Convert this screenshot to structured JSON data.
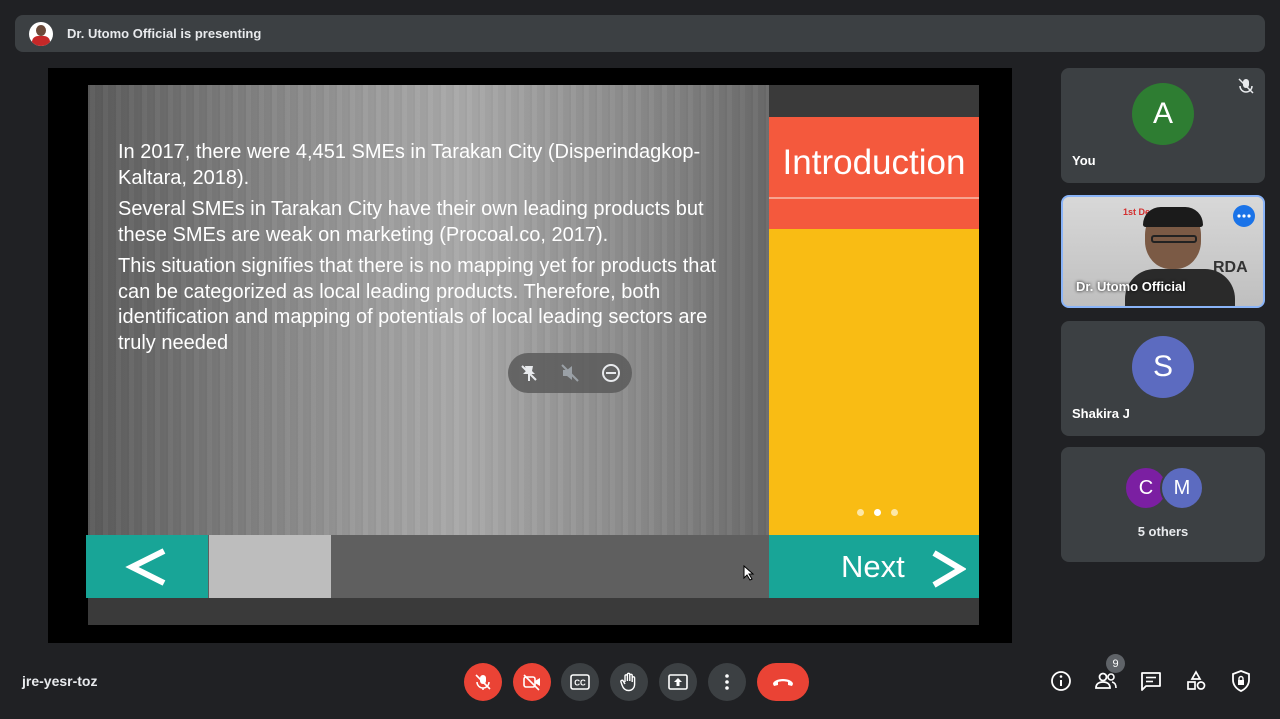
{
  "presenter_bar": {
    "text": "Dr. Utomo Official is presenting"
  },
  "slide": {
    "paragraphs": [
      "In 2017, there were 4,451 SMEs in Tarakan City (Disperindagkop-Kaltara, 2018).",
      "Several SMEs in Tarakan City have their own leading products but these SMEs are weak on marketing (Procoal.co, 2017).",
      "This situation signifies that there is no mapping yet for products that can be categorized as local leading products. Therefore, both identification and mapping of potentials of local leading sectors are truly needed"
    ],
    "section_title": "Introduction",
    "next_label": "Next",
    "prev_label": "<",
    "pager": {
      "count": 3,
      "active": 2
    }
  },
  "participants": {
    "you": {
      "initial": "A",
      "name": "You",
      "color": "#2e7d32"
    },
    "presenter": {
      "name": "Dr. Utomo Official",
      "video_text": "1st De",
      "banner_text": "RDA"
    },
    "shakira": {
      "initial": "S",
      "name": "Shakira J",
      "color": "#5c6bc0"
    },
    "others": {
      "initials": [
        "C",
        "M"
      ],
      "colors": [
        "#7b1fa2",
        "#5c6bc0"
      ],
      "label": "5 others"
    }
  },
  "bottom": {
    "meeting_code": "jre-yesr-toz",
    "people_count": "9"
  },
  "colors": {
    "accent_red": "#ea4335",
    "teal": "#18a597",
    "orange": "#f4593d",
    "yellow": "#f9bc14"
  }
}
